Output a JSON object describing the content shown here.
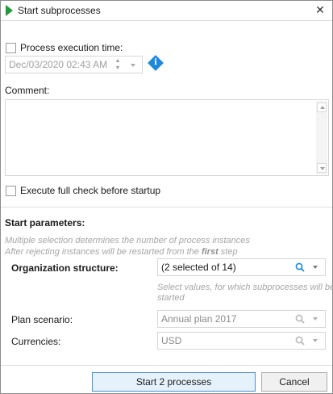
{
  "window": {
    "title": "Start subprocesses",
    "close_glyph": "✕"
  },
  "execution_time": {
    "checkbox_label": "Process execution time:",
    "checked": false,
    "datetime_value": "Dec/03/2020 02:43 AM",
    "info_icon": "info-diamond-icon"
  },
  "comment": {
    "label": "Comment:",
    "value": ""
  },
  "full_check": {
    "label": "Execute full check before startup",
    "checked": false
  },
  "start_parameters": {
    "heading": "Start parameters:",
    "hint_prefix": "Multiple selection determines the number of process instances",
    "hint_restart_1": "After rejecting instances will be restarted from the ",
    "hint_restart_bold": "first",
    "hint_restart_2": " step",
    "org_structure": {
      "label": "Organization structure:",
      "value": "(2 selected of 14)",
      "hint_line1": "Select values, for which subprocesses will be",
      "hint_line2": "started"
    },
    "plan_scenario": {
      "label": "Plan scenario:",
      "value": "Annual plan 2017"
    },
    "currencies": {
      "label": "Currencies:",
      "value": "USD"
    }
  },
  "buttons": {
    "start": "Start 2 processes",
    "cancel": "Cancel"
  },
  "colors": {
    "accent": "#1c8ad6",
    "play": "#1e9c3c",
    "search_active": "#1c8ad6",
    "search_disabled": "#b8b8b8"
  }
}
